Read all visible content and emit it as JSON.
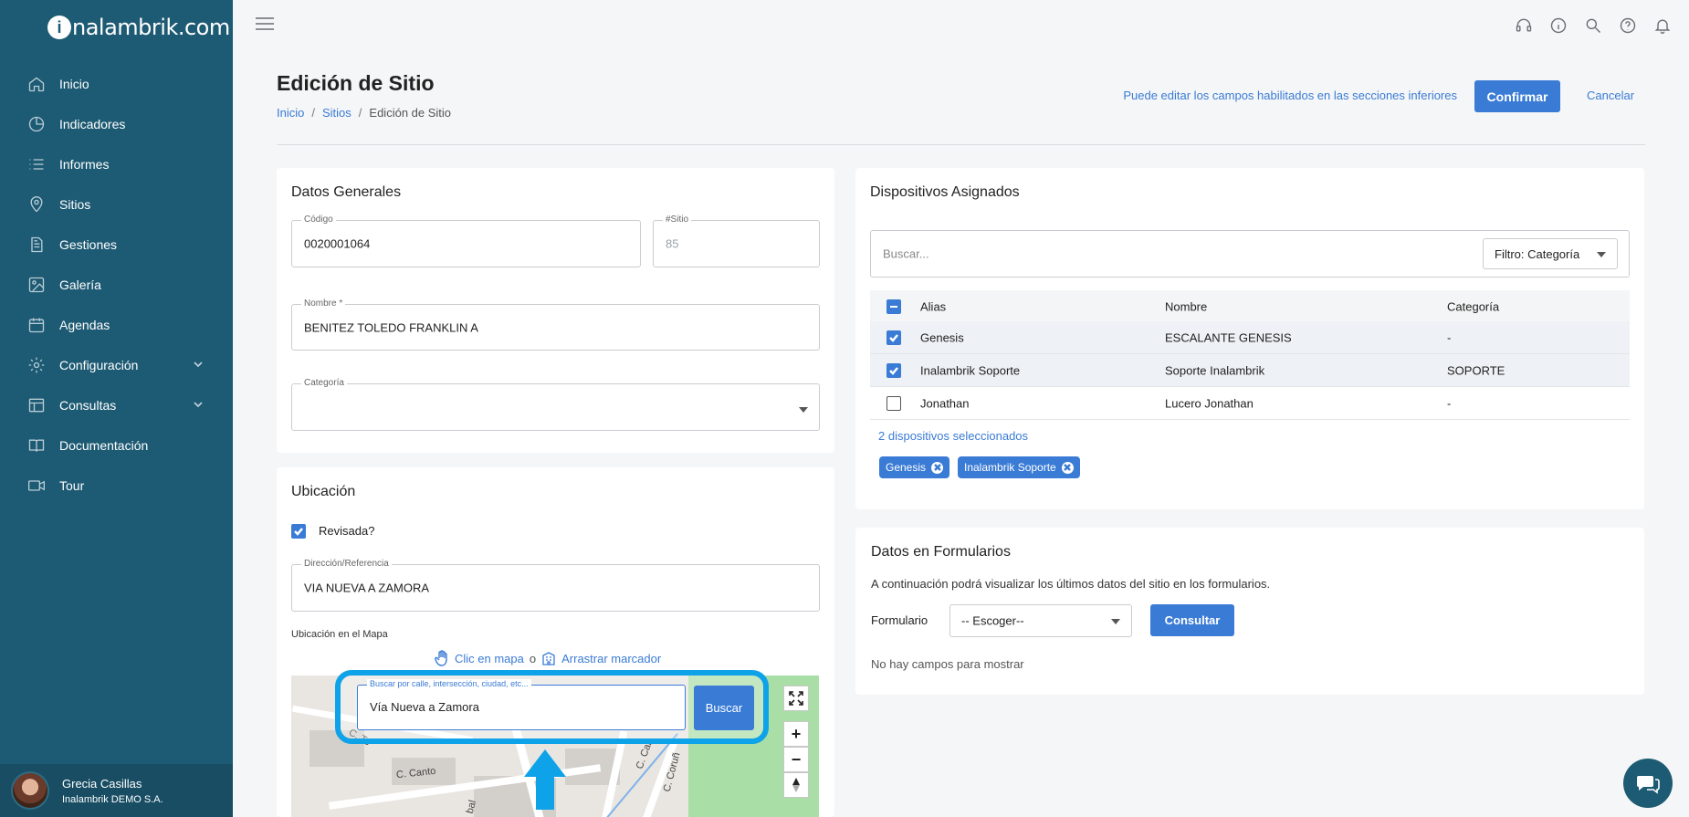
{
  "brand": {
    "logo_text": "nalambrik.com",
    "logo_mark": "i"
  },
  "sidebar": {
    "items": [
      {
        "label": "Inicio",
        "icon": "home-icon"
      },
      {
        "label": "Indicadores",
        "icon": "pie-chart-icon"
      },
      {
        "label": "Informes",
        "icon": "list-icon"
      },
      {
        "label": "Sitios",
        "icon": "location-pin-icon"
      },
      {
        "label": "Gestiones",
        "icon": "document-icon"
      },
      {
        "label": "Galería",
        "icon": "image-icon"
      },
      {
        "label": "Agendas",
        "icon": "calendar-icon"
      },
      {
        "label": "Configuración",
        "icon": "gear-icon",
        "expandable": true
      },
      {
        "label": "Consultas",
        "icon": "table-icon",
        "expandable": true
      },
      {
        "label": "Documentación",
        "icon": "book-icon"
      },
      {
        "label": "Tour",
        "icon": "video-icon"
      }
    ],
    "user": {
      "name": "Grecia Casillas",
      "org": "Inalambrik DEMO S.A."
    }
  },
  "topbar": {
    "icons": [
      "support-icon",
      "info-icon",
      "search-icon",
      "help-icon",
      "bell-icon"
    ]
  },
  "header": {
    "title": "Edición de Sitio",
    "breadcrumb": [
      "Inicio",
      "Sitios",
      "Edición de Sitio"
    ],
    "hint": "Puede editar los campos habilitados en las secciones inferiores",
    "confirm_label": "Confirmar",
    "cancel_label": "Cancelar"
  },
  "general": {
    "title": "Datos Generales",
    "codigo_label": "Código",
    "codigo_value": "0020001064",
    "sitio_label": "#Sitio",
    "sitio_value": "85",
    "nombre_label": "Nombre *",
    "nombre_value": "BENITEZ TOLEDO FRANKLIN A",
    "categoria_label": "Categoría",
    "categoria_value": ""
  },
  "ubicacion": {
    "title": "Ubicación",
    "revisada_label": "Revisada?",
    "revisada_checked": true,
    "direccion_label": "Dirección/Referencia",
    "direccion_value": "VIA NUEVA A ZAMORA",
    "mapa_label": "Ubicación en el Mapa",
    "clic_mapa": "Clic en mapa",
    "o": "o",
    "arrastrar": "Arrastrar marcador",
    "search_label": "Buscar por calle, intersección, ciudad, etc...",
    "search_value": "Vía Nueva a Zamora",
    "buscar_label": "Buscar",
    "street_labels": [
      "C. Canto",
      "C. Cab",
      "C. Coruñ",
      "bal",
      "C. To"
    ],
    "zoom_in": "+",
    "zoom_out": "−"
  },
  "dispositivos": {
    "title": "Dispositivos Asignados",
    "search_placeholder": "Buscar...",
    "filter_label": "Filtro: Categoría",
    "columns": [
      "Alias",
      "Nombre",
      "Categoría"
    ],
    "rows": [
      {
        "alias": "Genesis",
        "nombre": "ESCALANTE GENESIS",
        "categoria": "-",
        "checked": true
      },
      {
        "alias": "Inalambrik Soporte",
        "nombre": "Soporte Inalambrik",
        "categoria": "SOPORTE",
        "checked": true
      },
      {
        "alias": "Jonathan",
        "nombre": "Lucero Jonathan",
        "categoria": "-",
        "checked": false
      }
    ],
    "selected_count": "2 dispositivos seleccionados",
    "chips": [
      "Genesis",
      "Inalambrik Soporte"
    ]
  },
  "formularios": {
    "title": "Datos en Formularios",
    "description": "A continuación podrá visualizar los últimos datos del sitio en los formularios.",
    "formulario_label": "Formulario",
    "select_value": "-- Escoger--",
    "consultar_label": "Consultar",
    "empty_text": "No hay campos para mostrar"
  },
  "colors": {
    "sidebar": "#1d5a73",
    "accent": "#3a7bd5",
    "highlight": "#0ea2e8",
    "map_green": "#a9dfa6"
  }
}
